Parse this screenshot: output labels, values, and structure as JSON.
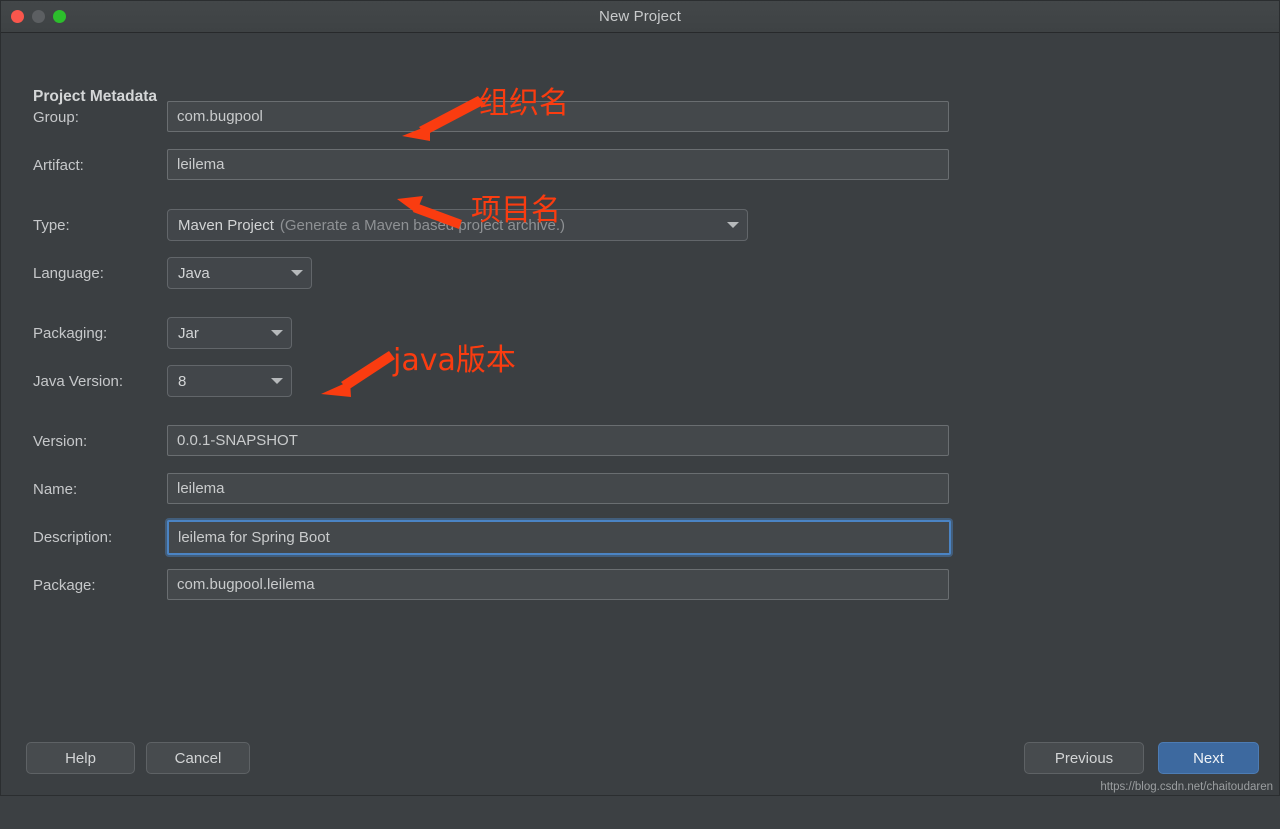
{
  "window": {
    "title": "New Project",
    "controls": [
      {
        "name": "close",
        "color": "#f9564c"
      },
      {
        "name": "minimize",
        "color": "#5c5f62"
      },
      {
        "name": "maximize",
        "color": "#2cbe2c"
      }
    ]
  },
  "form": {
    "section_title": "Project Metadata",
    "fields": {
      "group": {
        "label": "Group:",
        "value": "com.bugpool"
      },
      "artifact": {
        "label": "Artifact:",
        "value": "leilema"
      },
      "type": {
        "label": "Type:",
        "value": "Maven Project",
        "hint": "(Generate a Maven based project archive.)"
      },
      "language": {
        "label": "Language:",
        "value": "Java"
      },
      "packaging": {
        "label": "Packaging:",
        "value": "Jar"
      },
      "java_version": {
        "label": "Java Version:",
        "value": "8"
      },
      "version": {
        "label": "Version:",
        "value": "0.0.1-SNAPSHOT"
      },
      "name": {
        "label": "Name:",
        "value": "leilema"
      },
      "description": {
        "label": "Description:",
        "value": "leilema for Spring Boot"
      },
      "package": {
        "label": "Package:",
        "value": "com.bugpool.leilema"
      }
    }
  },
  "buttons": {
    "help": "Help",
    "cancel": "Cancel",
    "previous": "Previous",
    "next": "Next"
  },
  "annotations": [
    {
      "text": "组织名",
      "target": "group-field"
    },
    {
      "text": "项目名",
      "target": "artifact-field"
    },
    {
      "text": "java版本",
      "target": "java-version-combo"
    }
  ],
  "annotation_color": "#fa3c10",
  "watermark": "https://blog.csdn.net/chaitoudaren"
}
